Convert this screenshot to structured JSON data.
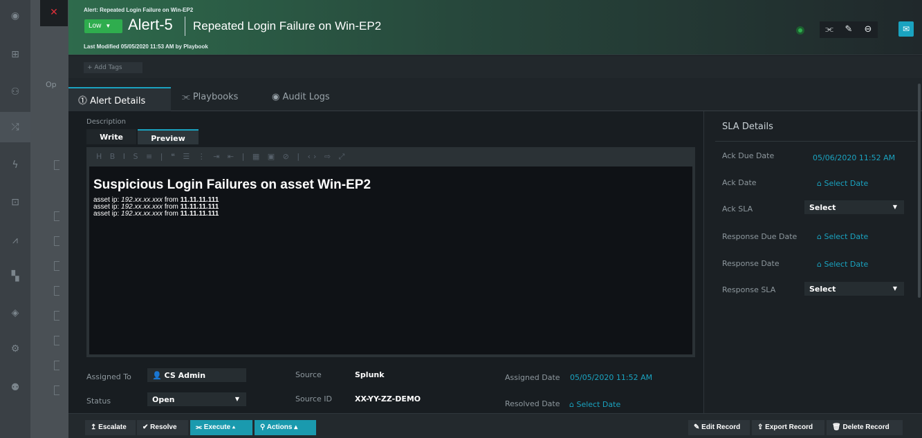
{
  "header": {
    "breadcrumb": "Alert: Repeated Login Failure on Win-EP2",
    "severity": "Low",
    "alert_id": "Alert-5",
    "alert_title": "Repeated Login Failure on Win-EP2",
    "last_modified": "Last Modified 05/05/2020 11:53 AM by Playbook",
    "icons": [
      "status-indicator-icon",
      "playbook-icon",
      "pencil-icon",
      "link-icon",
      "chat-icon"
    ]
  },
  "tags": {
    "add_label": "+ Add Tags"
  },
  "background": {
    "panel_label": "Op"
  },
  "tabs": [
    {
      "label": "Alert Details",
      "icon": "alert-icon"
    },
    {
      "label": "Playbooks",
      "icon": "playbook-icon"
    },
    {
      "label": "Audit Logs",
      "icon": "eye-icon"
    }
  ],
  "description": {
    "label": "Description",
    "write_tab": "Write",
    "preview_tab": "Preview",
    "toolbar": "H B I S ≡ | ❝ ☰ ⋮ ⇥ ⇤ | ▦ ▣ ⊘ | ‹› ⇨ ⤢",
    "heading": "Suspicious Login Failures on asset Win-EP2",
    "lines": [
      {
        "prefix": "asset ip: ",
        "ip": "192.xx.xx.xxx",
        "mid": " from ",
        "from": "11.11.11.111"
      },
      {
        "prefix": "asset ip: ",
        "ip": "192.xx.xx.xxx",
        "mid": " from ",
        "from": "11.11.11.111"
      },
      {
        "prefix": "asset ip: ",
        "ip": "192.xx.xx.xxx",
        "mid": " from ",
        "from": "11.11.11.111"
      }
    ]
  },
  "fields": {
    "assigned_to_label": "Assigned To",
    "assigned_to": "CS Admin",
    "status_label": "Status",
    "status": "Open",
    "source_label": "Source",
    "source": "Splunk",
    "source_id_label": "Source ID",
    "source_id": "XX-YY-ZZ-DEMO",
    "assigned_date_label": "Assigned Date",
    "assigned_date": "05/05/2020 11:52 AM",
    "resolved_date_label": "Resolved Date",
    "resolved_date": "Select Date"
  },
  "sla": {
    "title": "SLA Details",
    "ack_due_label": "Ack Due Date",
    "ack_due": "05/06/2020 11:52 AM",
    "ack_date_label": "Ack Date",
    "ack_date": "Select Date",
    "ack_sla_label": "Ack SLA",
    "ack_sla": "Select",
    "resp_due_label": "Response Due Date",
    "resp_due": "Select Date",
    "resp_date_label": "Response Date",
    "resp_date": "Select Date",
    "resp_sla_label": "Response SLA",
    "resp_sla": "Select"
  },
  "actions": {
    "escalate": "Escalate",
    "resolve": "Resolve",
    "execute": "Execute",
    "actions": "Actions",
    "edit": "Edit Record",
    "export": "Export Record",
    "delete": "Delete Record"
  },
  "colors": {
    "accent": "#1aa3c0",
    "severity_low": "#2fad4e",
    "header_green": "#2e6b4c"
  }
}
